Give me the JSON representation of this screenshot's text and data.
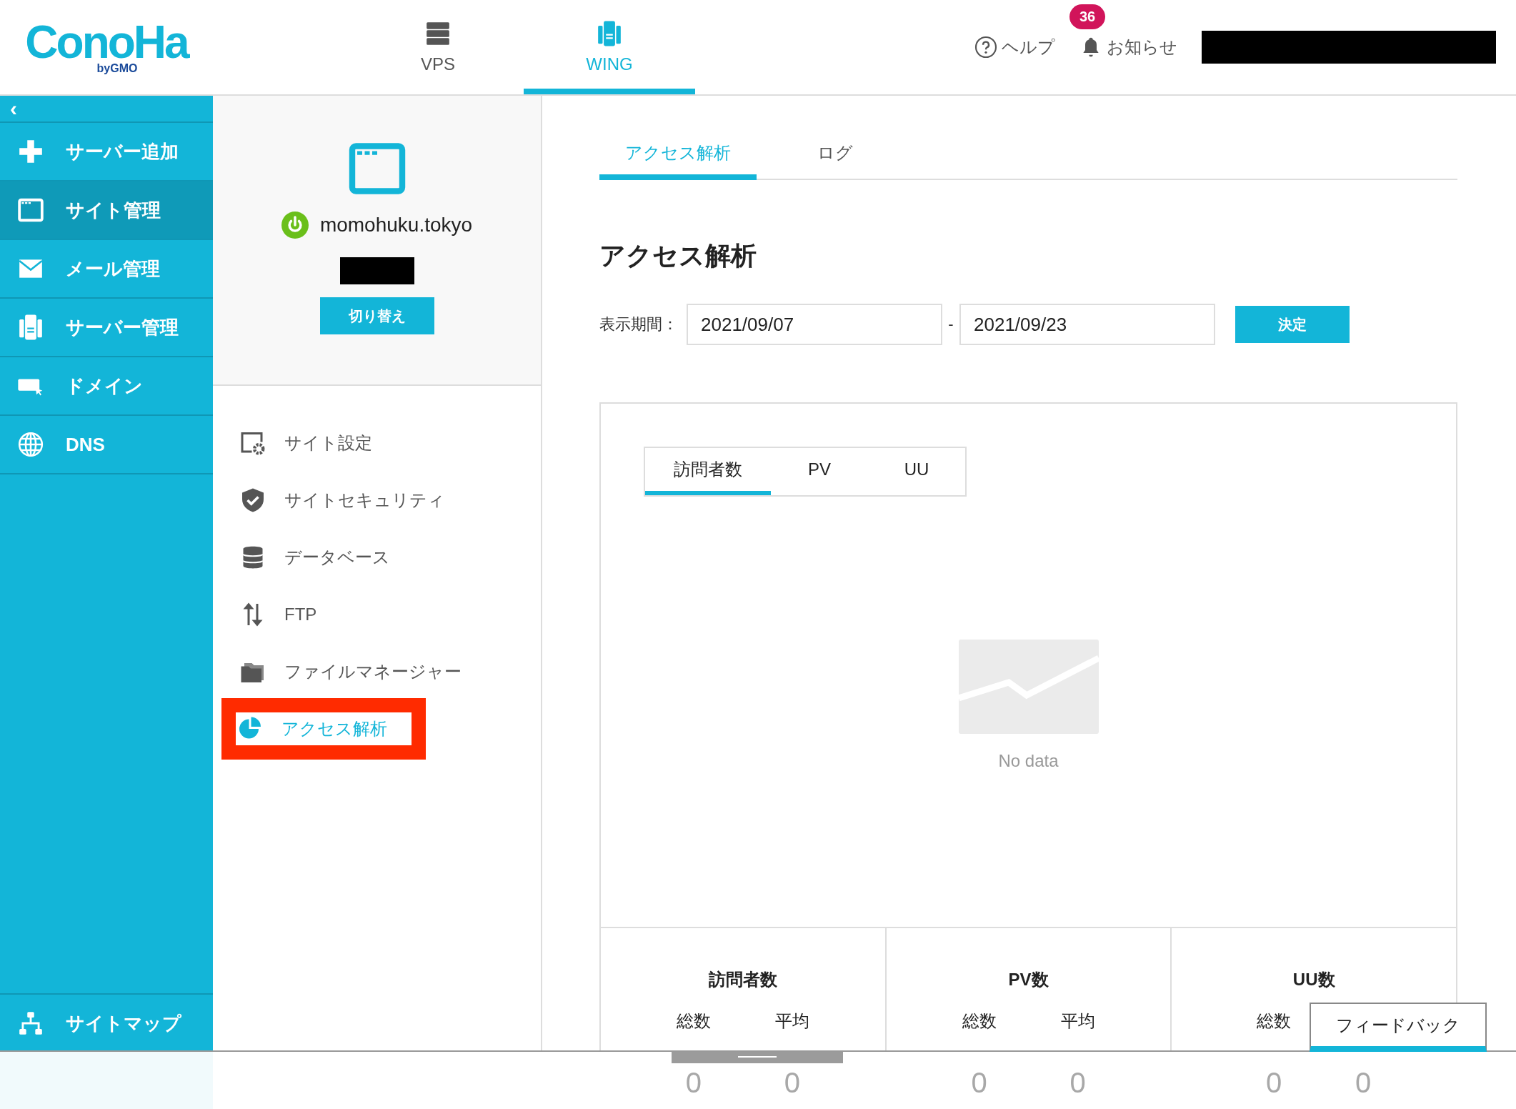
{
  "header": {
    "logo": {
      "name": "ConoHa",
      "tagline": "byGMO"
    },
    "nav": [
      {
        "label": "VPS",
        "kind": "rack",
        "selected": false
      },
      {
        "label": "WING",
        "kind": "server",
        "selected": true
      }
    ],
    "help": "ヘルプ",
    "notifications": {
      "label": "お知らせ",
      "badge": "36"
    }
  },
  "sidebar": {
    "collapse": "‹",
    "items": [
      {
        "label": "サーバー追加",
        "kind": "plus",
        "selected": false
      },
      {
        "label": "サイト管理",
        "kind": "window",
        "selected": true
      },
      {
        "label": "メール管理",
        "kind": "mail",
        "selected": false
      },
      {
        "label": "サーバー管理",
        "kind": "server",
        "selected": false
      },
      {
        "label": "ドメイン",
        "kind": "domain",
        "selected": false
      },
      {
        "label": "DNS",
        "kind": "globe",
        "selected": false
      }
    ],
    "footer": {
      "label": "サイトマップ",
      "kind": "sitemap"
    }
  },
  "site": {
    "domain": "momohuku.tokyo",
    "running": true,
    "switch_button": "切り替え"
  },
  "site_menu": [
    {
      "label": "サイト設定",
      "kind": "settings",
      "selected": false,
      "highlighted": false
    },
    {
      "label": "サイトセキュリティ",
      "kind": "shield",
      "selected": false,
      "highlighted": false
    },
    {
      "label": "データベース",
      "kind": "database",
      "selected": false,
      "highlighted": false
    },
    {
      "label": "FTP",
      "kind": "arrows",
      "selected": false,
      "highlighted": false
    },
    {
      "label": "ファイルマネージャー",
      "kind": "folder",
      "selected": false,
      "highlighted": false
    },
    {
      "label": "アクセス解析",
      "kind": "pie",
      "selected": true,
      "highlighted": true
    }
  ],
  "tabs": [
    {
      "label": "アクセス解析",
      "selected": true
    },
    {
      "label": "ログ",
      "selected": false
    }
  ],
  "heading": "アクセス解析",
  "period": {
    "label": "表示期間：",
    "from": "2021/09/07",
    "separator": "-",
    "to": "2021/09/23",
    "button": "決定"
  },
  "chart_tabs": [
    {
      "label": "訪問者数",
      "selected": true
    },
    {
      "label": "PV",
      "selected": false
    },
    {
      "label": "UU",
      "selected": false
    }
  ],
  "empty_message": "No data",
  "stats": [
    {
      "title": "訪問者数",
      "items": [
        {
          "label": "総数",
          "value": "0"
        },
        {
          "label": "平均",
          "value": "0"
        }
      ]
    },
    {
      "title": "PV数",
      "items": [
        {
          "label": "総数",
          "value": "0"
        },
        {
          "label": "平均",
          "value": "0"
        }
      ]
    },
    {
      "title": "UU数",
      "items": [
        {
          "label": "総数",
          "value": "0"
        },
        {
          "value": "0"
        }
      ]
    }
  ],
  "feedback_button": "フィードバック"
}
